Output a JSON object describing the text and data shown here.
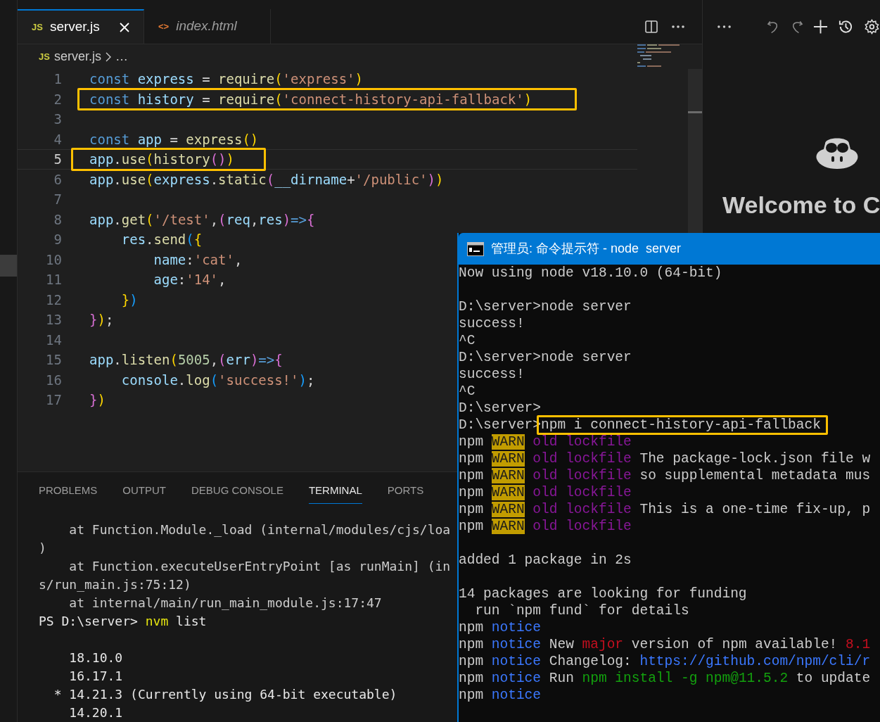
{
  "editor": {
    "tabs": [
      {
        "icon_text": "JS",
        "label": "server.js",
        "selected": true,
        "italic": false
      },
      {
        "icon_text": "<>",
        "label": "index.html",
        "selected": false,
        "italic": true
      }
    ],
    "breadcrumb": {
      "icon_text": "JS",
      "file": "server.js",
      "rest": "…"
    },
    "lines": [
      {
        "number": "1",
        "current": false,
        "highlighted": false,
        "tokens": [
          {
            "text": "const",
            "kind": "kw"
          },
          {
            "text": " express ",
            "kind": "var"
          },
          {
            "text": "= ",
            "kind": "punct"
          },
          {
            "text": "require",
            "kind": "fn"
          },
          {
            "text": "(",
            "kind": "b1"
          },
          {
            "text": "'express'",
            "kind": "str"
          },
          {
            "text": ")",
            "kind": "b1"
          }
        ]
      },
      {
        "number": "2",
        "current": false,
        "highlighted": true,
        "tokens": [
          {
            "text": "const",
            "kind": "kw"
          },
          {
            "text": " history ",
            "kind": "var"
          },
          {
            "text": "= ",
            "kind": "punct"
          },
          {
            "text": "require",
            "kind": "fn"
          },
          {
            "text": "(",
            "kind": "b1"
          },
          {
            "text": "'connect-history-api-fallback'",
            "kind": "str"
          },
          {
            "text": ")",
            "kind": "b1"
          }
        ]
      },
      {
        "number": "3",
        "current": false,
        "highlighted": false
      },
      {
        "number": "4",
        "current": false,
        "highlighted": false,
        "tokens": [
          {
            "text": "const",
            "kind": "kw"
          },
          {
            "text": " app ",
            "kind": "var"
          },
          {
            "text": "= ",
            "kind": "punct"
          },
          {
            "text": "express",
            "kind": "fn"
          },
          {
            "text": "()",
            "kind": "b1"
          }
        ]
      },
      {
        "number": "5",
        "current": true,
        "highlighted": true,
        "tokens": [
          {
            "text": "app",
            "kind": "var"
          },
          {
            "text": ".",
            "kind": "punct"
          },
          {
            "text": "use",
            "kind": "fn"
          },
          {
            "text": "(",
            "kind": "b1"
          },
          {
            "text": "history",
            "kind": "fn"
          },
          {
            "text": "()",
            "kind": "b2"
          },
          {
            "text": ")",
            "kind": "b1"
          }
        ]
      },
      {
        "number": "6",
        "current": false,
        "highlighted": false,
        "tokens": [
          {
            "text": "app",
            "kind": "var"
          },
          {
            "text": ".",
            "kind": "punct"
          },
          {
            "text": "use",
            "kind": "fn"
          },
          {
            "text": "(",
            "kind": "b1"
          },
          {
            "text": "express",
            "kind": "var"
          },
          {
            "text": ".",
            "kind": "punct"
          },
          {
            "text": "static",
            "kind": "fn"
          },
          {
            "text": "(",
            "kind": "b2"
          },
          {
            "text": "__dirname",
            "kind": "var"
          },
          {
            "text": "+",
            "kind": "punct"
          },
          {
            "text": "'/public'",
            "kind": "str"
          },
          {
            "text": ")",
            "kind": "b2"
          },
          {
            "text": ")",
            "kind": "b1"
          }
        ]
      },
      {
        "number": "7",
        "current": false,
        "highlighted": false
      },
      {
        "number": "8",
        "current": false,
        "highlighted": false,
        "tokens": [
          {
            "text": "app",
            "kind": "var"
          },
          {
            "text": ".",
            "kind": "punct"
          },
          {
            "text": "get",
            "kind": "fn"
          },
          {
            "text": "(",
            "kind": "b1"
          },
          {
            "text": "'/test'",
            "kind": "str"
          },
          {
            "text": ",",
            "kind": "punct"
          },
          {
            "text": "(",
            "kind": "b2"
          },
          {
            "text": "req",
            "kind": "var"
          },
          {
            "text": ",",
            "kind": "punct"
          },
          {
            "text": "res",
            "kind": "var"
          },
          {
            "text": ")",
            "kind": "b2"
          },
          {
            "text": "=>",
            "kind": "kw"
          },
          {
            "text": "{",
            "kind": "b2"
          }
        ]
      },
      {
        "number": "9",
        "current": false,
        "highlighted": false,
        "tokens": [
          {
            "text": "    res",
            "kind": "var"
          },
          {
            "text": ".",
            "kind": "punct"
          },
          {
            "text": "send",
            "kind": "fn"
          },
          {
            "text": "(",
            "kind": "b3"
          },
          {
            "text": "{",
            "kind": "b1"
          }
        ]
      },
      {
        "number": "10",
        "current": false,
        "highlighted": false,
        "tokens": [
          {
            "text": "        name",
            "kind": "var"
          },
          {
            "text": ":",
            "kind": "punct"
          },
          {
            "text": "'cat'",
            "kind": "str"
          },
          {
            "text": ",",
            "kind": "punct"
          }
        ]
      },
      {
        "number": "11",
        "current": false,
        "highlighted": false,
        "tokens": [
          {
            "text": "        age",
            "kind": "var"
          },
          {
            "text": ":",
            "kind": "punct"
          },
          {
            "text": "'14'",
            "kind": "str"
          },
          {
            "text": ",",
            "kind": "punct"
          }
        ]
      },
      {
        "number": "12",
        "current": false,
        "highlighted": false,
        "tokens": [
          {
            "text": "    }",
            "kind": "b1"
          },
          {
            "text": ")",
            "kind": "b3"
          }
        ]
      },
      {
        "number": "13",
        "current": false,
        "highlighted": false,
        "tokens": [
          {
            "text": "}",
            "kind": "b2"
          },
          {
            "text": ")",
            "kind": "b1"
          },
          {
            "text": ";",
            "kind": "punct"
          }
        ]
      },
      {
        "number": "14",
        "current": false,
        "highlighted": false
      },
      {
        "number": "15",
        "current": false,
        "highlighted": false,
        "tokens": [
          {
            "text": "app",
            "kind": "var"
          },
          {
            "text": ".",
            "kind": "punct"
          },
          {
            "text": "listen",
            "kind": "fn"
          },
          {
            "text": "(",
            "kind": "b1"
          },
          {
            "text": "5005",
            "kind": "num"
          },
          {
            "text": ",",
            "kind": "punct"
          },
          {
            "text": "(",
            "kind": "b2"
          },
          {
            "text": "err",
            "kind": "var"
          },
          {
            "text": ")",
            "kind": "b2"
          },
          {
            "text": "=>",
            "kind": "kw"
          },
          {
            "text": "{",
            "kind": "b2"
          }
        ]
      },
      {
        "number": "16",
        "current": false,
        "highlighted": false,
        "tokens": [
          {
            "text": "    console",
            "kind": "var"
          },
          {
            "text": ".",
            "kind": "punct"
          },
          {
            "text": "log",
            "kind": "fn"
          },
          {
            "text": "(",
            "kind": "b3"
          },
          {
            "text": "'success!'",
            "kind": "str"
          },
          {
            "text": ")",
            "kind": "b3"
          },
          {
            "text": ";",
            "kind": "punct"
          }
        ]
      },
      {
        "number": "17",
        "current": false,
        "highlighted": false,
        "tokens": [
          {
            "text": "}",
            "kind": "b2"
          },
          {
            "text": ")",
            "kind": "b1"
          }
        ]
      }
    ]
  },
  "panel": {
    "tabs": [
      {
        "label": "PROBLEMS",
        "selected": false
      },
      {
        "label": "OUTPUT",
        "selected": false
      },
      {
        "label": "DEBUG CONSOLE",
        "selected": false
      },
      {
        "label": "TERMINAL",
        "selected": true
      },
      {
        "label": "PORTS",
        "selected": false
      }
    ],
    "terminal": [
      {
        "kind": "line",
        "tokens": [
          {
            "text": "    at Function.Module._load (internal/modules/cjs/loa",
            "kind": "dim"
          }
        ]
      },
      {
        "kind": "line",
        "tokens": [
          {
            "text": ")",
            "kind": "dim"
          }
        ]
      },
      {
        "kind": "line",
        "tokens": [
          {
            "text": "    at Function.executeUserEntryPoint [as runMain] (in",
            "kind": "dim"
          }
        ]
      },
      {
        "kind": "line",
        "tokens": [
          {
            "text": "s/run_main.js:75:12)",
            "kind": "dim"
          }
        ]
      },
      {
        "kind": "line",
        "tokens": [
          {
            "text": "    at internal/main/run_main_module.js:17:47",
            "kind": "dim"
          }
        ]
      },
      {
        "kind": "line",
        "tokens": [
          {
            "text": "PS D:\\server> ",
            "kind": "bright"
          },
          {
            "text": "nvm",
            "kind": "cmd"
          },
          {
            "text": " list",
            "kind": "bright"
          }
        ]
      },
      {
        "kind": "blank"
      },
      {
        "kind": "line",
        "tokens": [
          {
            "text": "    18.10.0",
            "kind": "bright"
          }
        ]
      },
      {
        "kind": "line",
        "tokens": [
          {
            "text": "    16.17.1",
            "kind": "bright"
          }
        ]
      },
      {
        "kind": "line",
        "tokens": [
          {
            "text": "  * 14.21.3 (Currently using 64-bit executable)",
            "kind": "bright"
          }
        ]
      },
      {
        "kind": "line",
        "tokens": [
          {
            "text": "    14.20.1",
            "kind": "bright"
          }
        ]
      }
    ]
  },
  "side_panel": {
    "welcome": "Welcome to C"
  },
  "console_window": {
    "title": "管理员: 命令提示符 - node  server",
    "lines": [
      {
        "kind": "line",
        "highlighted": false,
        "tokens": [
          {
            "text": "Now using node v18.10.0 (64-bit)",
            "kind": "plain"
          }
        ]
      },
      {
        "kind": "blank"
      },
      {
        "kind": "line",
        "highlighted": false,
        "tokens": [
          {
            "text": "D:\\server>node server",
            "kind": "plain"
          }
        ]
      },
      {
        "kind": "line",
        "highlighted": false,
        "tokens": [
          {
            "text": "success!",
            "kind": "plain"
          }
        ]
      },
      {
        "kind": "line",
        "highlighted": false,
        "tokens": [
          {
            "text": "^C",
            "kind": "plain"
          }
        ]
      },
      {
        "kind": "line",
        "highlighted": false,
        "tokens": [
          {
            "text": "D:\\server>node server",
            "kind": "plain"
          }
        ]
      },
      {
        "kind": "line",
        "highlighted": false,
        "tokens": [
          {
            "text": "success!",
            "kind": "plain"
          }
        ]
      },
      {
        "kind": "line",
        "highlighted": false,
        "tokens": [
          {
            "text": "^C",
            "kind": "plain"
          }
        ]
      },
      {
        "kind": "line",
        "highlighted": false,
        "tokens": [
          {
            "text": "D:\\server>",
            "kind": "prompt"
          }
        ]
      },
      {
        "kind": "line",
        "highlighted": true,
        "tokens": [
          {
            "text": "D:\\server>",
            "kind": "prompt"
          },
          {
            "text": "npm i connect-history-api-fallback",
            "kind": "plain"
          }
        ]
      },
      {
        "kind": "line",
        "highlighted": false,
        "tokens": [
          {
            "text": "npm ",
            "kind": "plain"
          },
          {
            "text": "WARN",
            "kind": "warn"
          },
          {
            "text": " old lockfile",
            "kind": "magenta"
          }
        ]
      },
      {
        "kind": "line",
        "highlighted": false,
        "tokens": [
          {
            "text": "npm ",
            "kind": "plain"
          },
          {
            "text": "WARN",
            "kind": "warn"
          },
          {
            "text": " old lockfile",
            "kind": "magenta"
          },
          {
            "text": " The package-lock.json file w",
            "kind": "plain"
          }
        ]
      },
      {
        "kind": "line",
        "highlighted": false,
        "tokens": [
          {
            "text": "npm ",
            "kind": "plain"
          },
          {
            "text": "WARN",
            "kind": "warn"
          },
          {
            "text": " old lockfile",
            "kind": "magenta"
          },
          {
            "text": " so supplemental metadata mus",
            "kind": "plain"
          }
        ]
      },
      {
        "kind": "line",
        "highlighted": false,
        "tokens": [
          {
            "text": "npm ",
            "kind": "plain"
          },
          {
            "text": "WARN",
            "kind": "warn"
          },
          {
            "text": " old lockfile",
            "kind": "magenta"
          }
        ]
      },
      {
        "kind": "line",
        "highlighted": false,
        "tokens": [
          {
            "text": "npm ",
            "kind": "plain"
          },
          {
            "text": "WARN",
            "kind": "warn"
          },
          {
            "text": " old lockfile",
            "kind": "magenta"
          },
          {
            "text": " This is a one-time fix-up, p",
            "kind": "plain"
          }
        ]
      },
      {
        "kind": "line",
        "highlighted": false,
        "tokens": [
          {
            "text": "npm ",
            "kind": "plain"
          },
          {
            "text": "WARN",
            "kind": "warn"
          },
          {
            "text": " old lockfile",
            "kind": "magenta"
          }
        ]
      },
      {
        "kind": "blank"
      },
      {
        "kind": "line",
        "highlighted": false,
        "tokens": [
          {
            "text": "added 1 package in 2s",
            "kind": "plain"
          }
        ]
      },
      {
        "kind": "blank"
      },
      {
        "kind": "line",
        "highlighted": false,
        "tokens": [
          {
            "text": "14 packages are looking for funding",
            "kind": "plain"
          }
        ]
      },
      {
        "kind": "line",
        "highlighted": false,
        "tokens": [
          {
            "text": "  run `npm fund` for details",
            "kind": "plain"
          }
        ]
      },
      {
        "kind": "line",
        "highlighted": false,
        "tokens": [
          {
            "text": "npm ",
            "kind": "plain"
          },
          {
            "text": "notice",
            "kind": "blue"
          }
        ]
      },
      {
        "kind": "line",
        "highlighted": false,
        "tokens": [
          {
            "text": "npm ",
            "kind": "plain"
          },
          {
            "text": "notice",
            "kind": "blue"
          },
          {
            "text": " New ",
            "kind": "plain"
          },
          {
            "text": "major",
            "kind": "red"
          },
          {
            "text": " version of npm available! ",
            "kind": "plain"
          },
          {
            "text": "8.1",
            "kind": "red"
          }
        ]
      },
      {
        "kind": "line",
        "highlighted": false,
        "tokens": [
          {
            "text": "npm ",
            "kind": "plain"
          },
          {
            "text": "notice",
            "kind": "blue"
          },
          {
            "text": " Changelog: ",
            "kind": "plain"
          },
          {
            "text": "https://github.com/npm/cli/r",
            "kind": "blue"
          }
        ]
      },
      {
        "kind": "line",
        "highlighted": false,
        "tokens": [
          {
            "text": "npm ",
            "kind": "plain"
          },
          {
            "text": "notice",
            "kind": "blue"
          },
          {
            "text": " Run ",
            "kind": "plain"
          },
          {
            "text": "npm install -g npm@11.5.2",
            "kind": "green"
          },
          {
            "text": " to update",
            "kind": "plain"
          }
        ]
      },
      {
        "kind": "line",
        "highlighted": false,
        "tokens": [
          {
            "text": "npm ",
            "kind": "plain"
          },
          {
            "text": "notice",
            "kind": "blue"
          }
        ]
      }
    ]
  }
}
